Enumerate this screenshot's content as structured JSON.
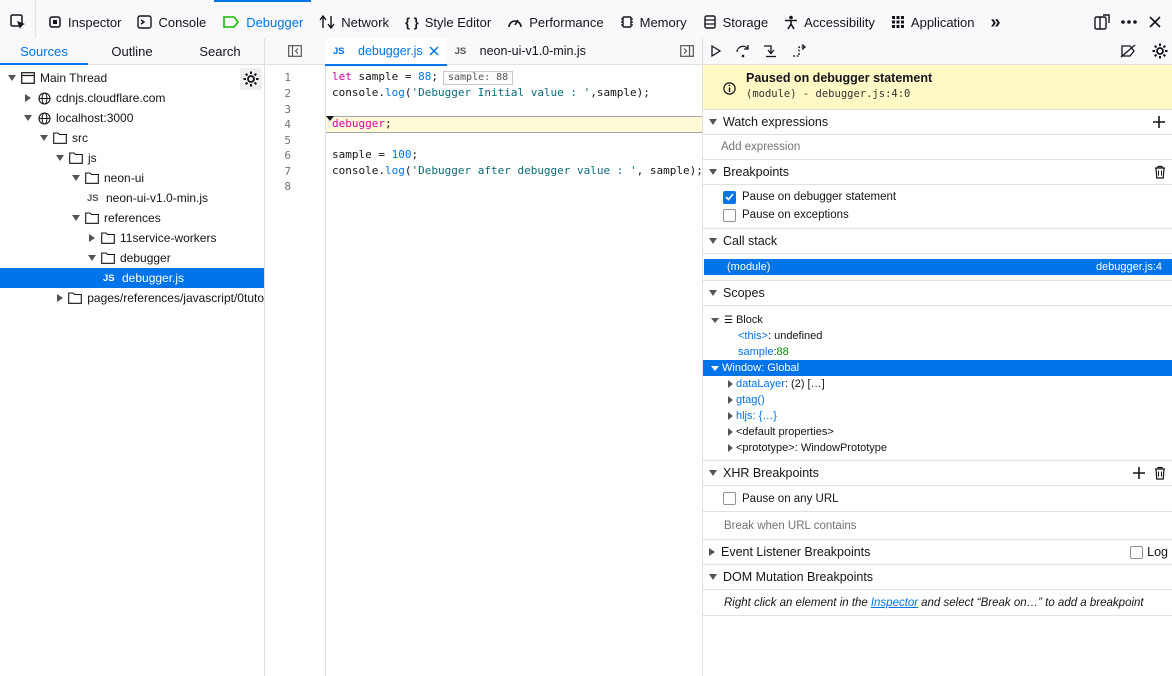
{
  "toolbar": {
    "tabs": [
      {
        "label": "Inspector",
        "icon": "inspector-icon"
      },
      {
        "label": "Console",
        "icon": "console-icon"
      },
      {
        "label": "Debugger",
        "icon": "debugger-icon"
      },
      {
        "label": "Network",
        "icon": "network-icon"
      },
      {
        "label": "Style Editor",
        "icon": "style-editor-icon"
      },
      {
        "label": "Performance",
        "icon": "performance-icon"
      },
      {
        "label": "Memory",
        "icon": "memory-icon"
      },
      {
        "label": "Storage",
        "icon": "storage-icon"
      },
      {
        "label": "Accessibility",
        "icon": "accessibility-icon"
      },
      {
        "label": "Application",
        "icon": "application-icon"
      }
    ],
    "selected": "Debugger",
    "overflow": "»"
  },
  "sources": {
    "tabs": [
      "Sources",
      "Outline",
      "Search"
    ],
    "tree": [
      {
        "label": "Main Thread"
      },
      {
        "label": "cdnjs.cloudflare.com"
      },
      {
        "label": "localhost:3000"
      },
      {
        "label": "src"
      },
      {
        "label": "js"
      },
      {
        "label": "neon-ui"
      },
      {
        "label": "neon-ui-v1.0-min.js"
      },
      {
        "label": "references"
      },
      {
        "label": "11service-workers"
      },
      {
        "label": "debugger"
      },
      {
        "label": "debugger.js"
      },
      {
        "label": "pages/references/javascript/0tuto"
      }
    ]
  },
  "editor": {
    "tabs": [
      {
        "label": "debugger.js"
      },
      {
        "label": "neon-ui-v1.0-min.js"
      }
    ],
    "line_numbers": [
      "1",
      "2",
      "3",
      "4",
      "5",
      "6",
      "7",
      "8"
    ],
    "lines": {
      "l1": {
        "kw": "let",
        "rest": " sample = ",
        "num": "88",
        "end": ";",
        "preview": "sample: 88"
      },
      "l2": {
        "a": "console.",
        "fn": "log",
        "b": "(",
        "str": "'Debugger Initial value : '",
        "c": ",sample);"
      },
      "l4": {
        "kw": "debugger",
        "end": ";"
      },
      "l6": {
        "a": "sample = ",
        "num": "100",
        "end": ";"
      },
      "l7": {
        "a": "console.",
        "fn": "log",
        "b": "(",
        "str": "'Debugger after debugger value : '",
        "c": ", sample);"
      }
    }
  },
  "right": {
    "paused": {
      "title": "Paused on debugger statement",
      "location": "(module) - debugger.js:4:0"
    },
    "watch": {
      "title": "Watch expressions",
      "placeholder": "Add expression"
    },
    "breakpoints": {
      "title": "Breakpoints",
      "items": [
        {
          "label": "Pause on debugger statement",
          "checked": true
        },
        {
          "label": "Pause on exceptions",
          "checked": false
        }
      ]
    },
    "callstack": {
      "title": "Call stack",
      "frame": "(module)",
      "location": "debugger.js:4"
    },
    "scopes": {
      "title": "Scopes",
      "block": "Block",
      "this_key": "<this>",
      "this_val": ": undefined",
      "sample_key": "sample",
      "sample_val": "88",
      "window": "Window: Global",
      "datalayer_key": "dataLayer",
      "datalayer_val": ": (2) […]",
      "gtag": "gtag()",
      "hljs_key": "hljs",
      "hljs_val": ": {…}",
      "default_props": "<default properties>",
      "proto_key": "<prototype>",
      "proto_val": ": WindowPrototype"
    },
    "xhr": {
      "title": "XHR Breakpoints",
      "item": "Pause on any URL",
      "placeholder": "Break when URL contains"
    },
    "event": {
      "title": "Event Listener Breakpoints",
      "log": "Log"
    },
    "dom": {
      "title": "DOM Mutation Breakpoints",
      "hint_pre": "Right click an element in the ",
      "hint_link": "Inspector",
      "hint_post": " and select “Break on…” to add a breakpoint"
    }
  }
}
